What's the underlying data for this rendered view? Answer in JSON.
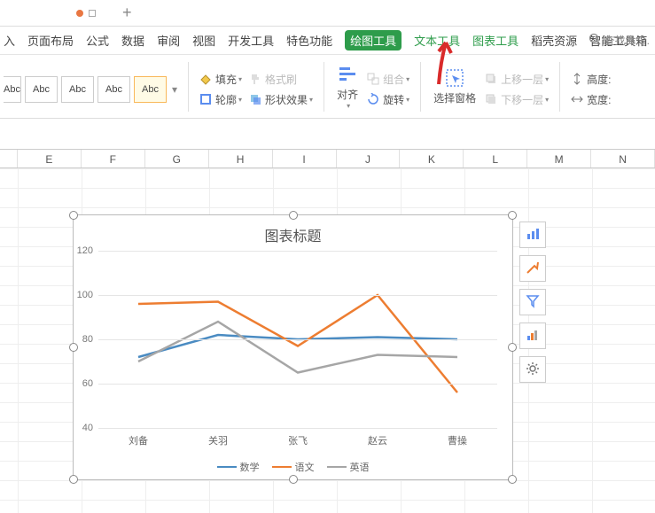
{
  "titlebar": {
    "newtab_label": "+"
  },
  "menu": {
    "items": [
      "入",
      "页面布局",
      "公式",
      "数据",
      "审阅",
      "视图",
      "开发工具",
      "特色功能",
      "绘图工具",
      "文本工具",
      "图表工具",
      "稻壳资源",
      "智能工具箱"
    ],
    "active_index": 8,
    "green_indices": [
      9,
      10
    ],
    "search_placeholder": "查找命令."
  },
  "ribbon": {
    "shape_label": "Abc",
    "fill": "填充",
    "outline": "轮廓",
    "fmtpaint": "格式刷",
    "shapefx": "形状效果",
    "align": "对齐",
    "group": "组合",
    "rotate": "旋转",
    "selpane": "选择窗格",
    "bringfwd": "上移一层",
    "sendback": "下移一层",
    "height": "高度:",
    "width": "宽度:"
  },
  "columns": [
    "",
    "E",
    "F",
    "G",
    "H",
    "I",
    "J",
    "K",
    "L",
    "M",
    "N"
  ],
  "chart_data": {
    "type": "line",
    "title": "图表标题",
    "categories": [
      "刘备",
      "关羽",
      "张飞",
      "赵云",
      "曹操"
    ],
    "series": [
      {
        "name": "数学",
        "color": "#4a8bc2",
        "values": [
          72,
          82,
          80,
          81,
          80
        ]
      },
      {
        "name": "语文",
        "color": "#ed7d31",
        "values": [
          96,
          97,
          77,
          100,
          56
        ]
      },
      {
        "name": "英语",
        "color": "#a6a6a6",
        "values": [
          70,
          88,
          65,
          73,
          72
        ]
      }
    ],
    "ylim": [
      40,
      120
    ],
    "yticks": [
      40,
      60,
      80,
      100,
      120
    ],
    "xlabel": "",
    "ylabel": ""
  },
  "sidebtn_names": [
    "chart-elements-icon",
    "chart-style-icon",
    "chart-filter-icon",
    "chart-type-icon",
    "chart-settings-icon"
  ]
}
